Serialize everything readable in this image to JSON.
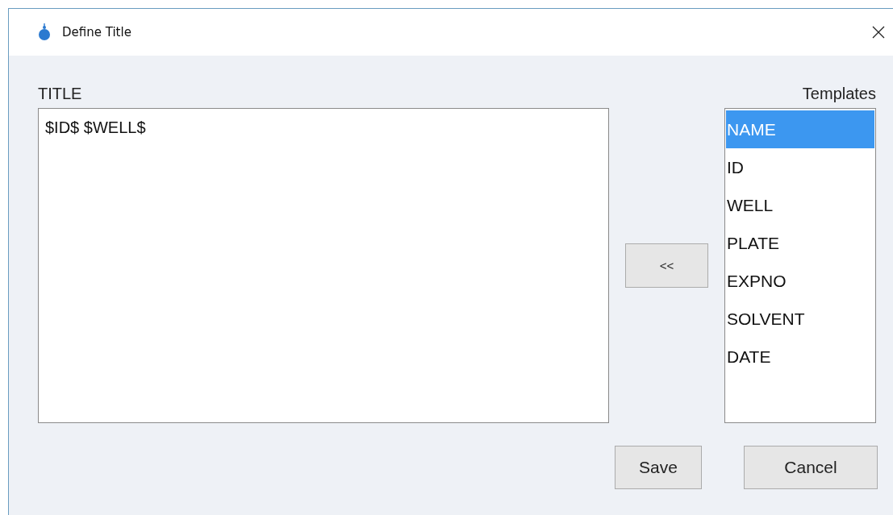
{
  "window": {
    "title": "Define Title"
  },
  "title_label": "TITLE",
  "title_field": {
    "value": "$ID$ $WELL$"
  },
  "insert_button": "<<",
  "templates": {
    "label": "Templates",
    "items": [
      {
        "label": "NAME",
        "selected": true
      },
      {
        "label": "ID",
        "selected": false
      },
      {
        "label": "WELL",
        "selected": false
      },
      {
        "label": "PLATE",
        "selected": false
      },
      {
        "label": "EXPNO",
        "selected": false
      },
      {
        "label": "SOLVENT",
        "selected": false
      },
      {
        "label": "DATE",
        "selected": false
      }
    ]
  },
  "buttons": [
    "Save",
    "Cancel"
  ]
}
